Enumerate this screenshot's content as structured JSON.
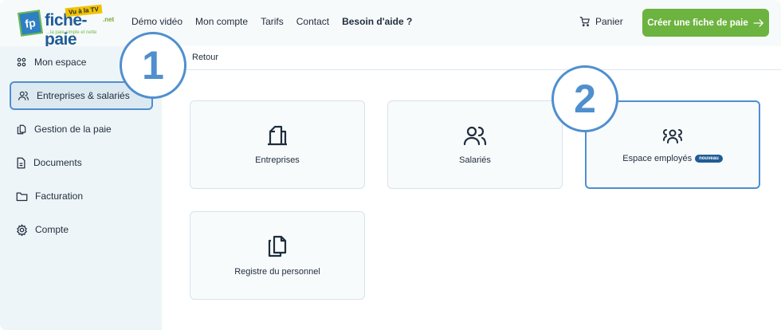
{
  "header": {
    "logo": {
      "initials": "fp",
      "word": "fiche-paie",
      "tv_badge": "Vu à la TV",
      "net": ".net",
      "tagline": "...la paie simple et nette"
    },
    "nav": [
      {
        "label": "Démo vidéo",
        "strong": false
      },
      {
        "label": "Mon compte",
        "strong": false
      },
      {
        "label": "Tarifs",
        "strong": false
      },
      {
        "label": "Contact",
        "strong": false
      },
      {
        "label": "Besoin d'aide ?",
        "strong": true
      }
    ],
    "cart_label": "Panier",
    "cta_label": "Créer une fiche de paie",
    "cta_icon": "arrow-right-icon",
    "accent_green": "#6db33f"
  },
  "sidebar": {
    "items": [
      {
        "label": "Mon espace",
        "icon": "grid-icon",
        "active": false
      },
      {
        "label": "Entreprises & salariés",
        "icon": "users-icon",
        "active": true
      },
      {
        "label": "Gestion de la paie",
        "icon": "files-icon",
        "active": false
      },
      {
        "label": "Documents",
        "icon": "document-icon",
        "active": false
      },
      {
        "label": "Facturation",
        "icon": "folder-icon",
        "active": false
      },
      {
        "label": "Compte",
        "icon": "gear-icon",
        "active": false
      }
    ]
  },
  "main": {
    "back_label": "Retour",
    "cards": [
      {
        "label": "Entreprises",
        "icon": "building-icon"
      },
      {
        "label": "Salariés",
        "icon": "users-icon"
      },
      {
        "label": "Espace employés",
        "icon": "team-icon",
        "badge": "nouveau"
      },
      {
        "label": "Registre du personnel",
        "icon": "files-icon"
      }
    ]
  },
  "markers": [
    "1",
    "2"
  ],
  "colors": {
    "highlight_blue": "#4f8fcf",
    "badge_blue": "#1f5c96"
  }
}
